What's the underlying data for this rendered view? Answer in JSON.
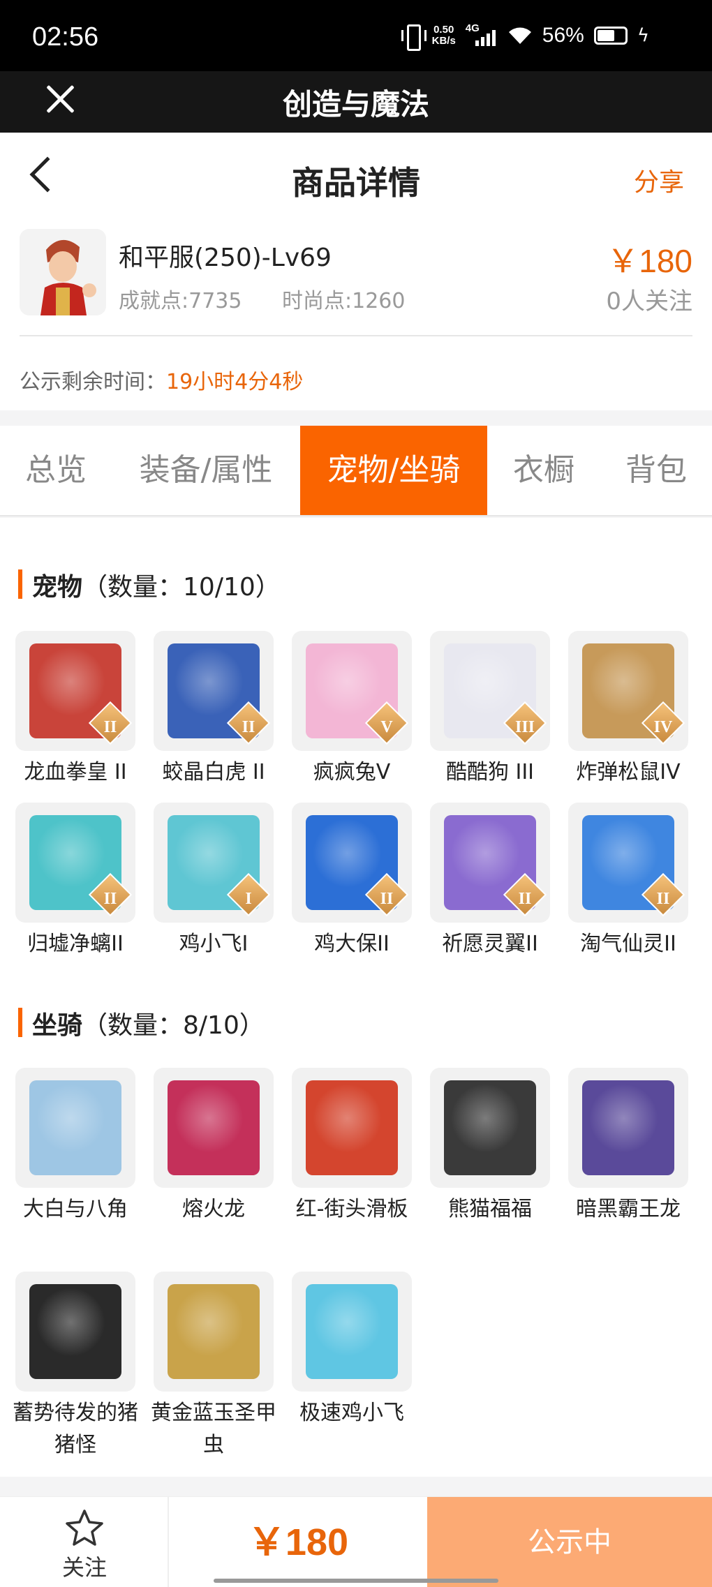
{
  "status_bar": {
    "time": "02:56",
    "speed_value": "0.50",
    "speed_unit": "KB/s",
    "network": "4G",
    "battery": "56%"
  },
  "app": {
    "title": "创造与魔法"
  },
  "nav": {
    "title": "商品详情",
    "share": "分享"
  },
  "product": {
    "name": "和平服(250)-Lv69",
    "achievement": "成就点:7735",
    "fashion": "时尚点:1260",
    "price": "￥180",
    "followers": "0人关注",
    "timer_label": "公示剩余时间：",
    "timer_value": "19小时4分4秒"
  },
  "tabs": [
    {
      "label": "总览",
      "active": false
    },
    {
      "label": "装备/属性",
      "active": false
    },
    {
      "label": "宠物/坐骑",
      "active": true
    },
    {
      "label": "衣橱",
      "active": false
    },
    {
      "label": "背包",
      "active": false
    }
  ],
  "pets": {
    "title": "宠物",
    "count": "（数量：10/10）",
    "items": [
      {
        "name": "龙血拳皇 II",
        "rank": "II",
        "color": "#c9443a"
      },
      {
        "name": "蛟晶白虎 II",
        "rank": "II",
        "color": "#3a62b8"
      },
      {
        "name": "疯疯兔V",
        "rank": "V",
        "color": "#f3b6d5"
      },
      {
        "name": "酷酷狗 III",
        "rank": "III",
        "color": "#e8e8f0"
      },
      {
        "name": "炸弹松鼠IV",
        "rank": "IV",
        "color": "#c79a5a"
      },
      {
        "name": "归墟净螭II",
        "rank": "II",
        "color": "#4ec3c9"
      },
      {
        "name": "鸡小飞I",
        "rank": "I",
        "color": "#5fc6d3"
      },
      {
        "name": "鸡大保II",
        "rank": "II",
        "color": "#2c6fd6"
      },
      {
        "name": "祈愿灵翼II",
        "rank": "II",
        "color": "#8a6bd0"
      },
      {
        "name": "淘气仙灵II",
        "rank": "II",
        "color": "#3f86e0"
      }
    ]
  },
  "mounts": {
    "title": "坐骑",
    "count": "（数量：8/10）",
    "items": [
      {
        "name": "大白与八角",
        "color": "#9ec6e4"
      },
      {
        "name": "熔火龙",
        "color": "#c4305a"
      },
      {
        "name": "红-街头滑板",
        "color": "#d4452e"
      },
      {
        "name": "熊猫福福",
        "color": "#3a3a3a"
      },
      {
        "name": "暗黑霸王龙",
        "color": "#5a4a9a"
      },
      {
        "name": "蓄势待发的猪猪怪",
        "color": "#2a2a2a"
      },
      {
        "name": "黄金蓝玉圣甲虫",
        "color": "#c9a34a"
      },
      {
        "name": "极速鸡小飞",
        "color": "#5fc6e3"
      }
    ]
  },
  "bottom": {
    "follow_label": "关注",
    "price": "￥180",
    "status": "公示中"
  },
  "colors": {
    "accent": "#fa6400",
    "price": "#e8650a",
    "status_button": "#fcaa74"
  }
}
